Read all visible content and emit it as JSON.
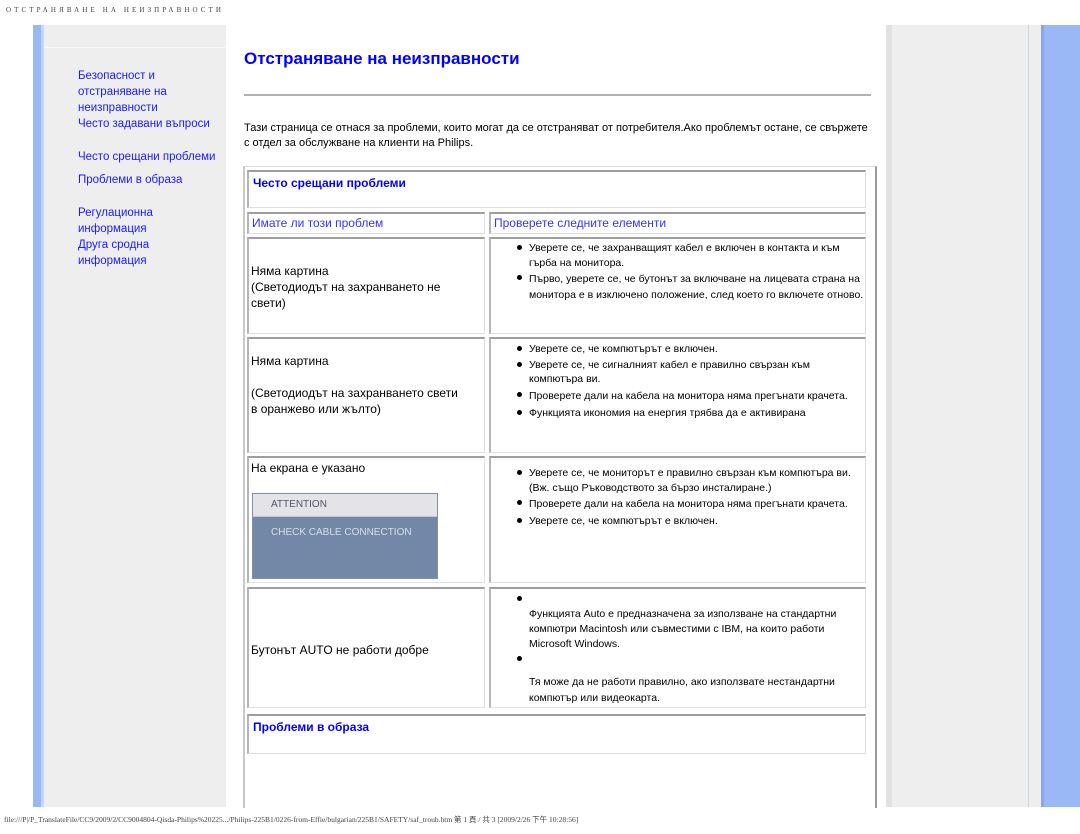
{
  "doc_header": "ОТСТРАНЯВАНЕ НА НЕИЗПРАВНОСТИ",
  "sidebar": {
    "items": [
      {
        "label": "Безопасност и отстраняване на неизправности",
        "lines": [
          "Безопасност и",
          "отстраняване на",
          "неизправности"
        ]
      },
      {
        "label": "Често задавани въпроси"
      },
      {
        "label": "Често срещани проблеми"
      },
      {
        "label": "Проблеми в образа"
      },
      {
        "label": "Регулационна информация",
        "lines": [
          "Регулационна",
          "информация"
        ]
      },
      {
        "label": "Друга сродна информация",
        "lines": [
          "Друга сродна",
          "информация"
        ]
      }
    ]
  },
  "main": {
    "title": "Отстраняване на неизправности",
    "intro": "Тази страница се отнася за проблеми, които могат да се отстраняват от потребителя.Ако проблемът остане, се свържете с отдел за обслужване на клиенти на Philips.",
    "section_common": "Често срещани проблеми",
    "col_problem": "Имате ли този проблем",
    "col_check": "Проверете следните елементи",
    "rows": [
      {
        "problem_lines": [
          "Няма картина",
          "(Светодиодът на захранването не",
          "свети)"
        ],
        "checks": [
          "Уверете се, че захранващият кабел е включен в контакта и към гърба на монитора.",
          "Първо, уверете се, че бутонът за включване на лицевата страна на монитора е в изключено положение, след което го включете отново."
        ]
      },
      {
        "problem_lines": [
          "Няма картина",
          "",
          "(Светодиодът на захранването свети",
          "в оранжево или жълто)"
        ],
        "checks": [
          "Уверете се, че компютърът е включен.",
          "Уверете се, че сигналният кабел е правилно свързан към компютъра ви.",
          "Проверете дали на кабела на монитора няма прегънати крачета.",
          "Функцията икономия на енергия трябва да е активирана"
        ]
      },
      {
        "problem_lines": [
          "На екрана е указано"
        ],
        "osd": {
          "title": "ATTENTION",
          "message": "CHECK CABLE CONNECTION"
        },
        "checks": [
          "Уверете се, че мониторът е правилно свързан към компютъра ви. (Вж. също Ръководството за бързо инсталиране.)",
          "Проверете дали на кабела на монитора няма прегънати крачета.",
          "Уверете се, че компютърът е включен."
        ]
      },
      {
        "problem_lines": [
          "Бутонът AUTO не работи добре"
        ],
        "checks": [
          "Функцията Auto е предназначена за използване на стандартни компютри Macintosh или съвместими с IBM, на които работи Microsoft Windows.",
          "Тя може да не работи правилно, ако използвате нестандартни компютър или видеокарта."
        ]
      }
    ],
    "section_image": "Проблеми в образа"
  },
  "footer": "file:///P|/P_TranslateFile/CC9/2009/2/CC9004804-Qisda-Philips%20225.../Philips-225B1/0226-from-Effie/bulgarian/225B1/SAFETY/saf_troub.htm 第 1 頁 / 共 3 [2009/2/26 下午 10:28:56]",
  "colors": {
    "link": "#0000ff",
    "accent_bar": "#99b8f5",
    "panel": "#eeeeee"
  }
}
